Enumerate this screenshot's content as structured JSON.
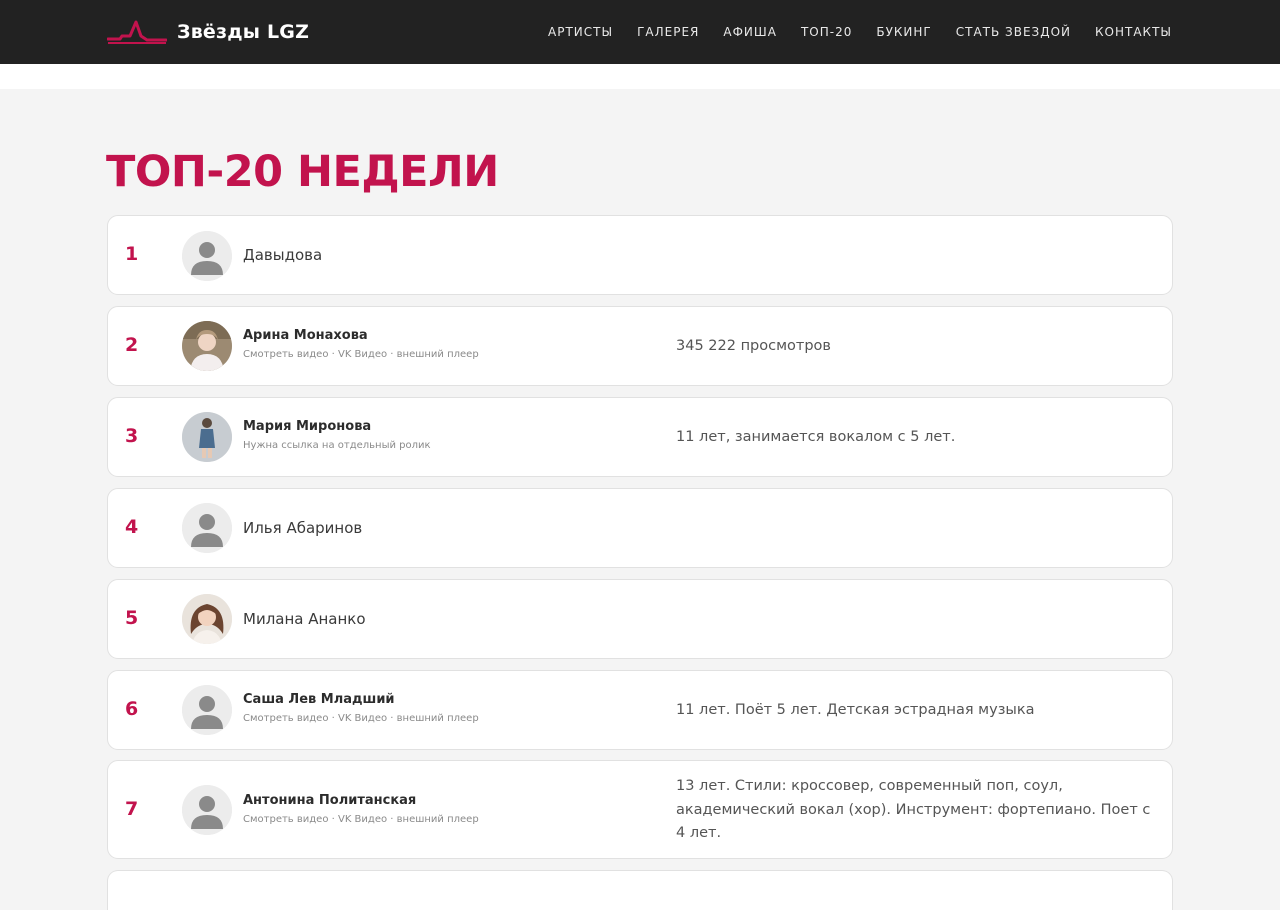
{
  "header": {
    "logo_text": "Звёзды LGZ",
    "nav": [
      "АРТИСТЫ",
      "ГАЛЕРЕЯ",
      "АФИША",
      "ТОП-20",
      "БУКИНГ",
      "СТАТЬ ЗВЕЗДОЙ",
      "КОНТАКТЫ"
    ]
  },
  "page": {
    "title": "ТОП-20 НЕДЕЛИ"
  },
  "ranking": [
    {
      "rank": "1",
      "name": "Давыдова",
      "avatar": "placeholder-avatar-icon"
    },
    {
      "rank": "2",
      "name": "Арина Монахова",
      "subtitle": "Смотреть видео · VK Видео · внешний плеер",
      "description": "345 222 просмотров",
      "avatar": "photo"
    },
    {
      "rank": "3",
      "name": "Мария Миронова",
      "subtitle": "Нужна ссылка на отдельный ролик",
      "description": "11 лет, занимается вокалом с 5 лет.",
      "avatar": "photo"
    },
    {
      "rank": "4",
      "name": "Илья Абаринов",
      "avatar": "placeholder-avatar-icon"
    },
    {
      "rank": "5",
      "name": "Милана Ананко",
      "avatar": "photo"
    },
    {
      "rank": "6",
      "name": "Саша Лев Младший",
      "subtitle": "Смотреть видео · VK Видео · внешний плеер",
      "description": "11 лет. Поёт 5 лет. Детская эстрадная музыка",
      "avatar": "placeholder-avatar-icon"
    },
    {
      "rank": "7",
      "name": "Антонина Политанская",
      "subtitle": "Смотреть видео · VK Видео · внешний плеер",
      "description": "13 лет. Стили: кроссовер, современный поп, соул, академический вокал (хор). Инструмент: фортепиано. Поет с 4 лет.",
      "avatar": "placeholder-avatar-icon"
    }
  ],
  "colors": {
    "accent": "#c2134d",
    "navbar": "#222222",
    "page_bg": "#f4f4f4",
    "card_bg": "#ffffff"
  }
}
